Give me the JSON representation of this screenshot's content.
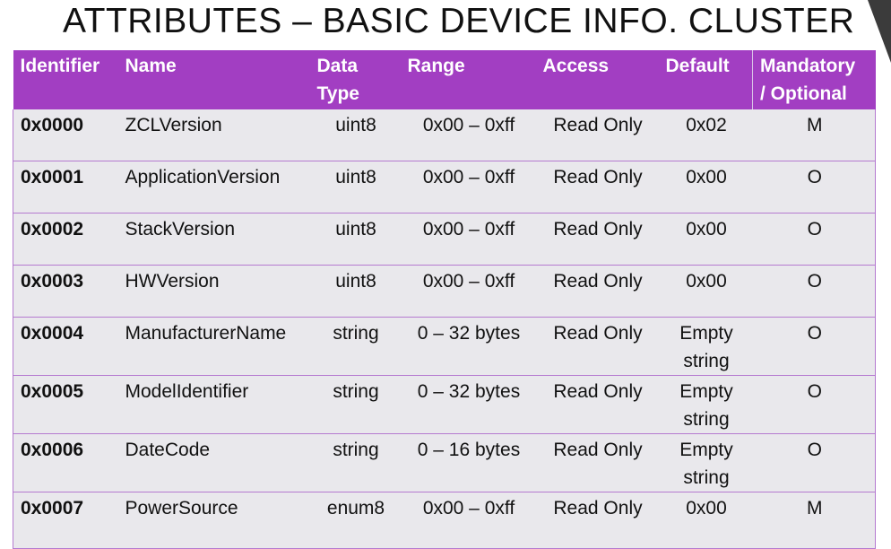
{
  "slide": {
    "title": "ATTRIBUTES – BASIC DEVICE INFO. CLUSTER"
  },
  "table": {
    "headers": {
      "identifier": "Identifier",
      "name": "Name",
      "data_type_1": "Data",
      "data_type_2": "Type",
      "range": "Range",
      "access": "Access",
      "default": "Default",
      "mandatory_1": "Mandatory",
      "mandatory_2": "/ Optional"
    },
    "rows": [
      {
        "id": "0x0000",
        "name": "ZCLVersion",
        "type": "uint8",
        "range": "0x00 – 0xff",
        "access": "Read Only",
        "default": "0x02",
        "default2": "",
        "mo": "M"
      },
      {
        "id": "0x0001",
        "name": "ApplicationVersion",
        "type": "uint8",
        "range": "0x00 – 0xff",
        "access": "Read Only",
        "default": "0x00",
        "default2": "",
        "mo": "O"
      },
      {
        "id": "0x0002",
        "name": "StackVersion",
        "type": "uint8",
        "range": "0x00 – 0xff",
        "access": "Read Only",
        "default": "0x00",
        "default2": "",
        "mo": "O"
      },
      {
        "id": "0x0003",
        "name": "HWVersion",
        "type": "uint8",
        "range": "0x00 – 0xff",
        "access": "Read Only",
        "default": "0x00",
        "default2": "",
        "mo": "O"
      },
      {
        "id": "0x0004",
        "name": "ManufacturerName",
        "type": "string",
        "range": "0 – 32 bytes",
        "access": "Read Only",
        "default": "Empty",
        "default2": "string",
        "mo": "O"
      },
      {
        "id": "0x0005",
        "name": "ModelIdentifier",
        "type": "string",
        "range": "0 – 32 bytes",
        "access": "Read Only",
        "default": "Empty",
        "default2": "string",
        "mo": "O"
      },
      {
        "id": "0x0006",
        "name": "DateCode",
        "type": "string",
        "range": "0 – 16 bytes",
        "access": "Read Only",
        "default": "Empty",
        "default2": "string",
        "mo": "O"
      },
      {
        "id": "0x0007",
        "name": "PowerSource",
        "type": "enum8",
        "range": "0x00 – 0xff",
        "access": "Read Only",
        "default": "0x00",
        "default2": "",
        "mo": "M"
      }
    ]
  },
  "colors": {
    "header_bg": "#a23ec2",
    "row_bg": "#e9e8ec",
    "row_border": "#b57ad0"
  }
}
